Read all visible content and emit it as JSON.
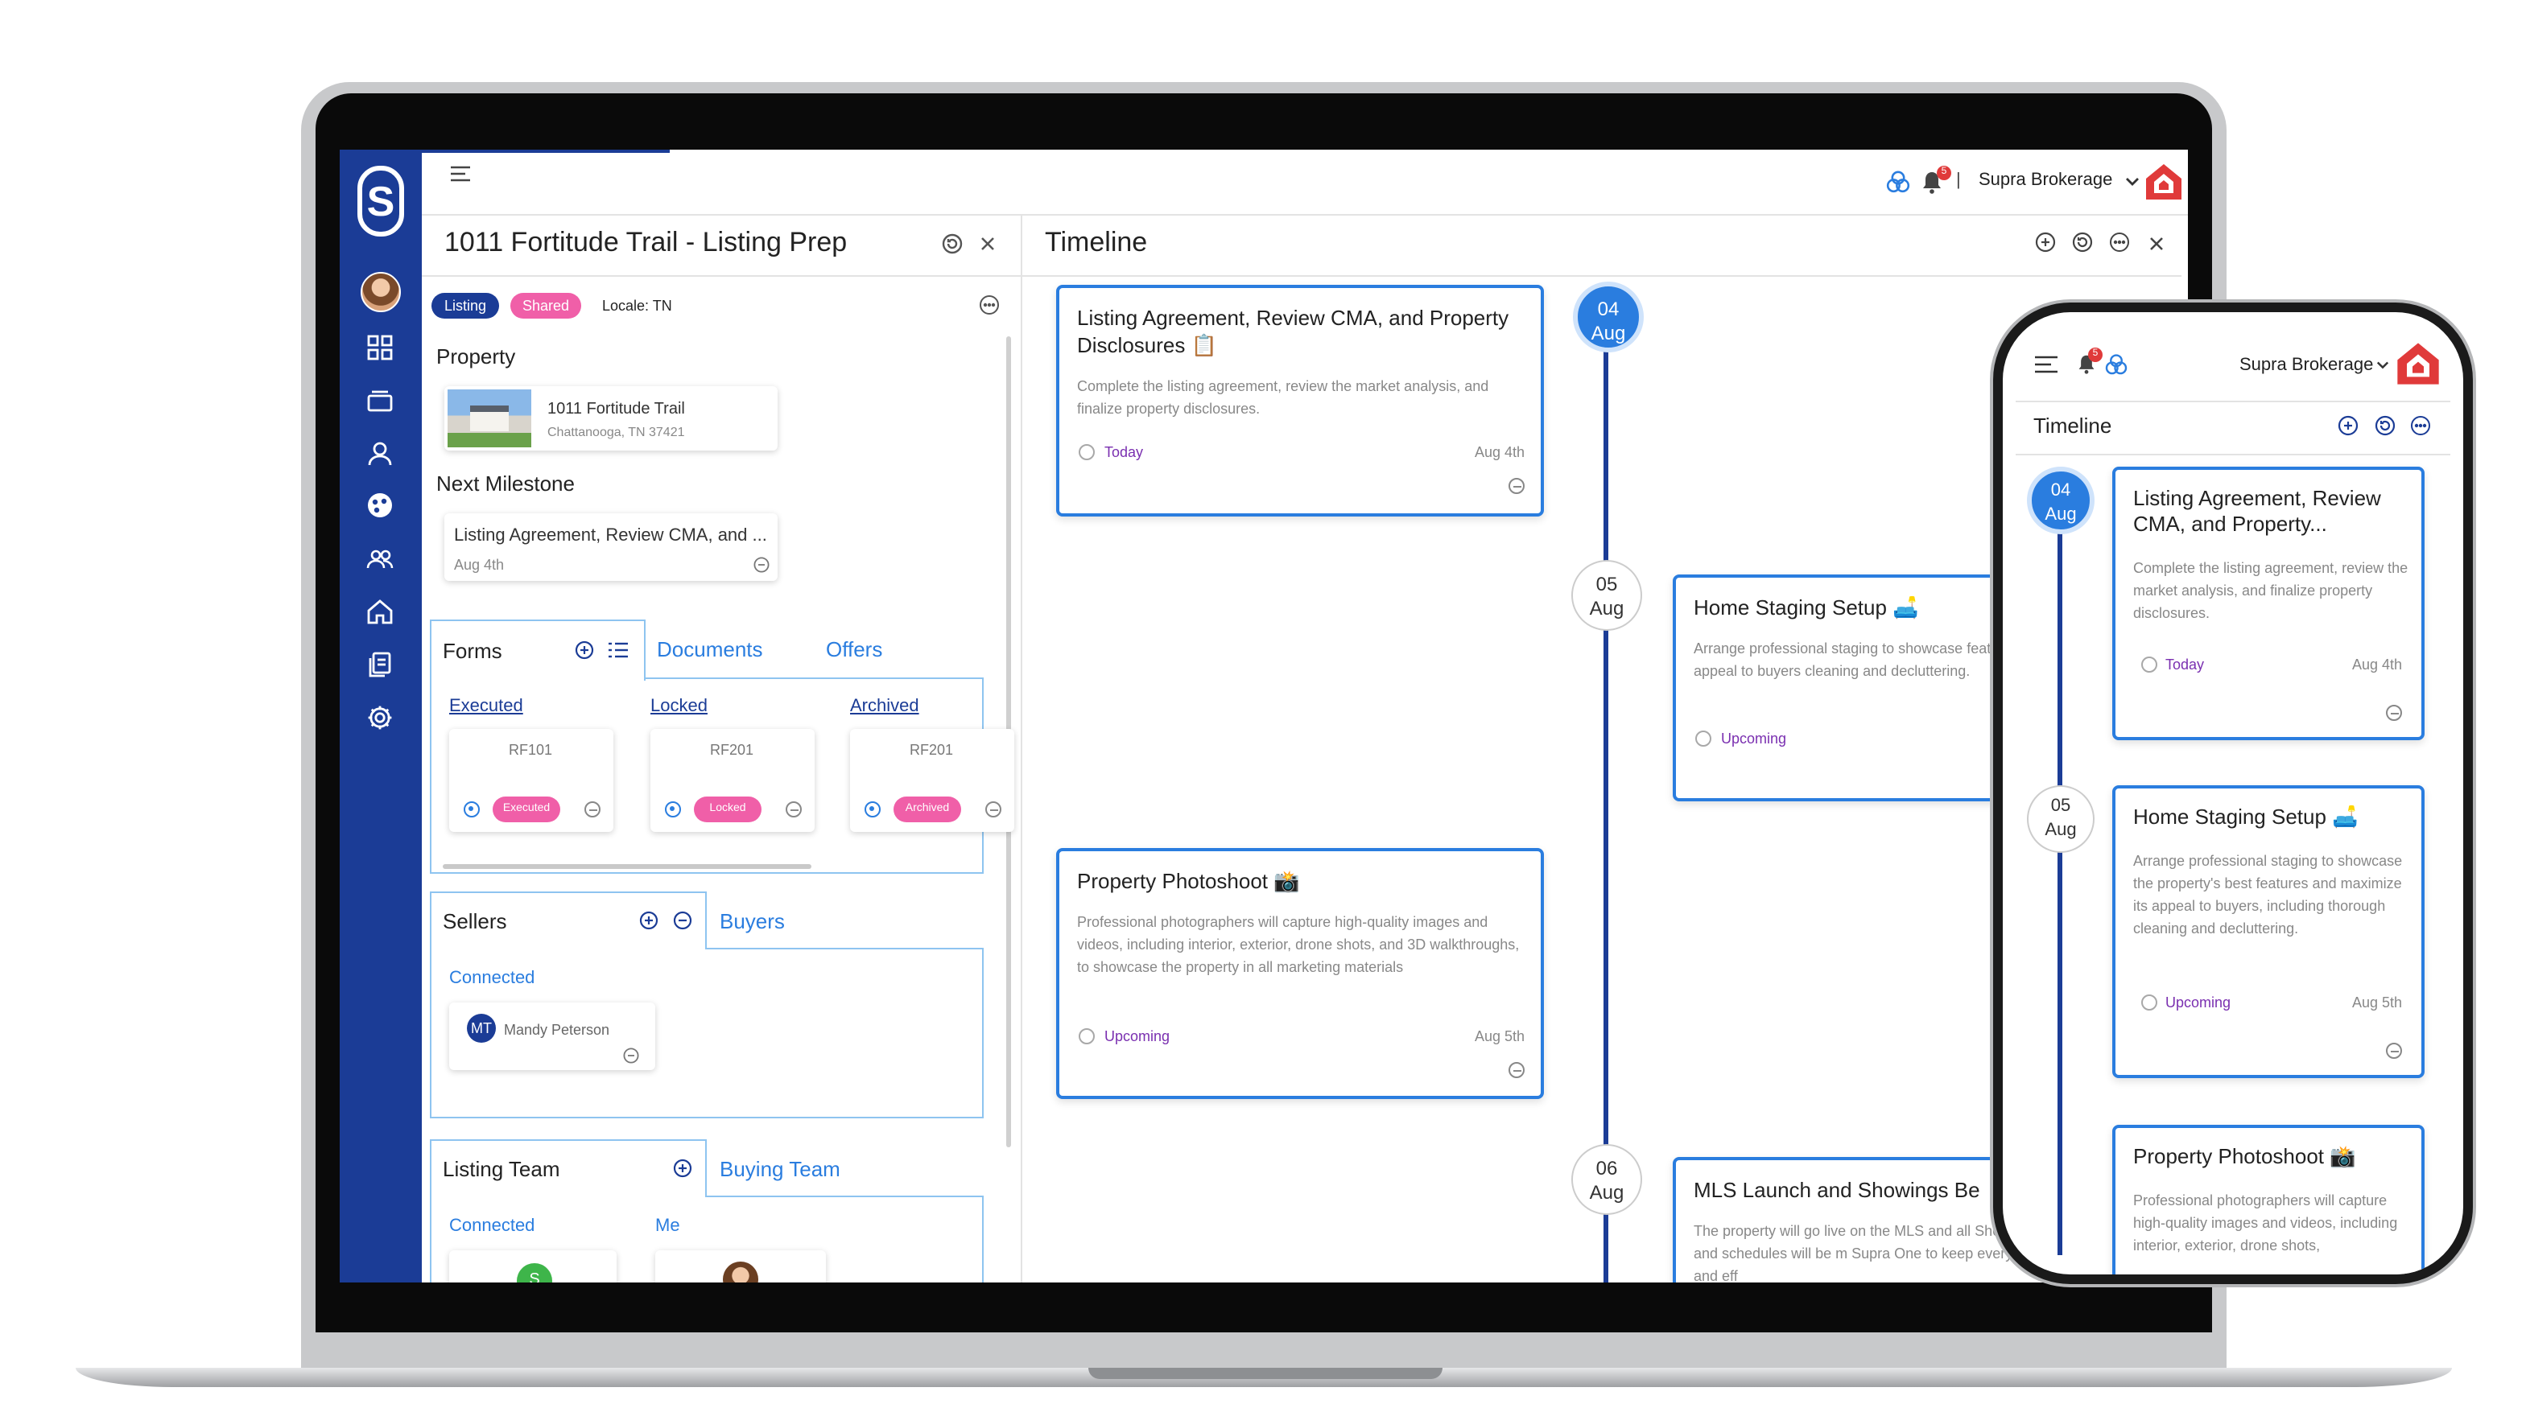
{
  "app": {
    "logo_letter": "S",
    "brokerage": "Supra Brokerage",
    "notification_count": "5",
    "separator": "|"
  },
  "left_panel": {
    "title": "1011 Fortitude Trail - Listing Prep",
    "badges": [
      "Listing",
      "Shared"
    ],
    "locale": "Locale: TN",
    "property_heading": "Property",
    "property": {
      "address": "1011 Fortitude Trail",
      "city": "Chattanooga,  TN  37421"
    },
    "milestone_heading": "Next Milestone",
    "milestone": {
      "title": "Listing Agreement, Review CMA, and ...",
      "date": "Aug 4th"
    },
    "doc_tabs": [
      "Forms",
      "Documents",
      "Offers"
    ],
    "form_groups": [
      {
        "label": "Executed",
        "code": "RF101",
        "status": "Executed"
      },
      {
        "label": "Locked",
        "code": "RF201",
        "status": "Locked"
      },
      {
        "label": "Archived",
        "code": "RF201",
        "status": "Archived"
      }
    ],
    "party_tabs": [
      "Sellers",
      "Buyers"
    ],
    "connected_label": "Connected",
    "seller": {
      "initials": "MT",
      "name": "Mandy Peterson"
    },
    "team_tabs": [
      "Listing Team",
      "Buying Team"
    ],
    "team_connected": "Connected",
    "team_me": "Me",
    "team_initial": "S"
  },
  "timeline": {
    "title": "Timeline",
    "events": [
      {
        "day": "04",
        "month": "Aug",
        "title": "Listing Agreement, Review CMA, and Property Disclosures 📋",
        "description": "Complete the listing agreement, review the market analysis, and finalize property disclosures.",
        "status": "Today",
        "date": "Aug 4th"
      },
      {
        "day": "05",
        "month": "Aug",
        "title": "Home Staging Setup 🛋️",
        "description": "Arrange professional staging to showcase the property's best features and maximize its appeal to buyers, including thorough cleaning and decluttering.",
        "status": "Upcoming",
        "date": "Aug 5th"
      },
      {
        "day": "05",
        "month": "Aug",
        "title": "Property Photoshoot 📸",
        "description": "Professional photographers will capture high-quality images and videos, including interior, exterior, drone shots, and 3D walkthroughs, to showcase the property in all marketing materials",
        "status": "Upcoming",
        "date": "Aug 5th"
      },
      {
        "day": "06",
        "month": "Aug",
        "title": "MLS Launch and Showings Be",
        "description": "The property will go live on the MLS and all Showings will begin, and schedules will be m Supra One to keep everything organized and eff",
        "status": "",
        "date": ""
      }
    ],
    "desktop_staging_desc": "Arrange professional staging to showcase features and maximize its appeal to buyers cleaning and decluttering."
  },
  "phone": {
    "brokerage": "Supra Brokerage",
    "notification_count": "5",
    "timeline_title": "Timeline",
    "events": [
      {
        "day": "04",
        "month": "Aug",
        "title": "Listing Agreement, Review CMA, and Property...",
        "description": "Complete the listing agreement, review the market analysis, and finalize property disclosures.",
        "status": "Today",
        "date": "Aug 4th"
      },
      {
        "day": "05",
        "month": "Aug",
        "title": "Home Staging Setup 🛋️",
        "description": "Arrange professional staging to showcase the property's best features and maximize its appeal to buyers, including thorough cleaning and decluttering.",
        "status": "Upcoming",
        "date": "Aug 5th"
      },
      {
        "title": "Property Photoshoot 📸",
        "description": "Professional photographers will capture high-quality images and videos, including interior, exterior, drone shots,"
      }
    ]
  },
  "colors": {
    "sidebar": "#1b3c96",
    "accent": "#2a7ddf",
    "pink": "#f05fa8",
    "brand_red": "#e03a3a",
    "status_purple": "#7a2fb0"
  },
  "icons": [
    "menu-icon",
    "dashboard-icon",
    "cards-icon",
    "person-icon",
    "palette-icon",
    "people-icon",
    "home-icon",
    "documents-icon",
    "gear-icon",
    "bell-icon",
    "circles-icon",
    "chevron-down-icon",
    "plus-circle-icon",
    "list-icon",
    "more-icon",
    "sync-icon",
    "close-icon"
  ]
}
